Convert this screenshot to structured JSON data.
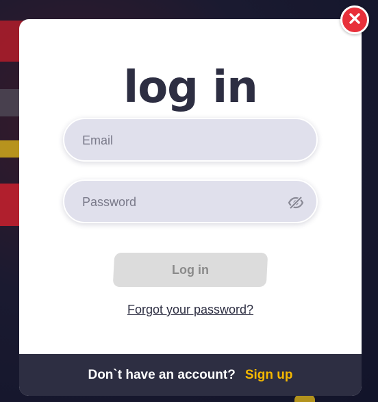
{
  "modal": {
    "title": "log in",
    "close_icon": "close-icon",
    "email": {
      "placeholder": "Email",
      "value": ""
    },
    "password": {
      "placeholder": "Password",
      "value": "",
      "toggle_icon": "eye-slash-icon"
    },
    "login_button_label": "Log in",
    "forgot_link": "Forgot your password?",
    "footer": {
      "prompt": "Don`t have an account?",
      "signup_label": "Sign up"
    }
  },
  "colors": {
    "title": "#2d2e42",
    "field_bg": "#e0e0ec",
    "button_disabled": "#dcdcdc",
    "footer_bg": "#2d2e42",
    "signup_accent": "#f5b800",
    "close_red": "#e8303a"
  }
}
